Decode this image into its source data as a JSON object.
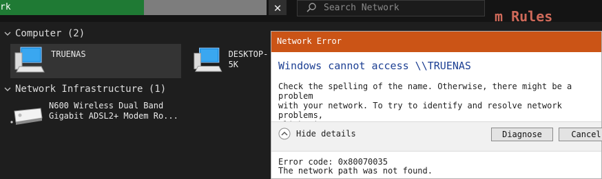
{
  "topbar": {
    "progress_text": "rk",
    "progress_fraction": 0.54,
    "close_glyph": "✕",
    "search_placeholder": "Search Network",
    "bg_text": "m Rules"
  },
  "groups": [
    {
      "label": "Computer (2)",
      "items": [
        {
          "label": "TRUENAS"
        },
        {
          "label": "DESKTOP-5K"
        }
      ]
    },
    {
      "label": "Network Infrastructure (1)",
      "items": [
        {
          "label": "N600 Wireless Dual Band\nGigabit ADSL2+ Modem Ro..."
        }
      ]
    }
  ],
  "dialog": {
    "title": "Network Error",
    "heading": "Windows cannot access \\\\TRUENAS",
    "message": "Check the spelling of the name. Otherwise, there might be a problem\nwith your network. To try to identify and resolve network problems,\nclick Diagnose.",
    "toggle_label": "Hide details",
    "diagnose_label": "Diagnose",
    "cancel_label": "Cancel",
    "error_code": "Error code: 0x80070035",
    "error_desc": "The network path was not found."
  },
  "colors": {
    "dialog_titlebar": "#cb5416",
    "heading": "#1c3f93",
    "progress_fill": "#1f7a34"
  },
  "icons": {
    "search": "search-icon",
    "close": "close-icon",
    "computer": "computer-icon",
    "router": "router-icon",
    "chevron": "chevron-down-icon",
    "details_toggle": "chevron-up-circle-icon"
  }
}
